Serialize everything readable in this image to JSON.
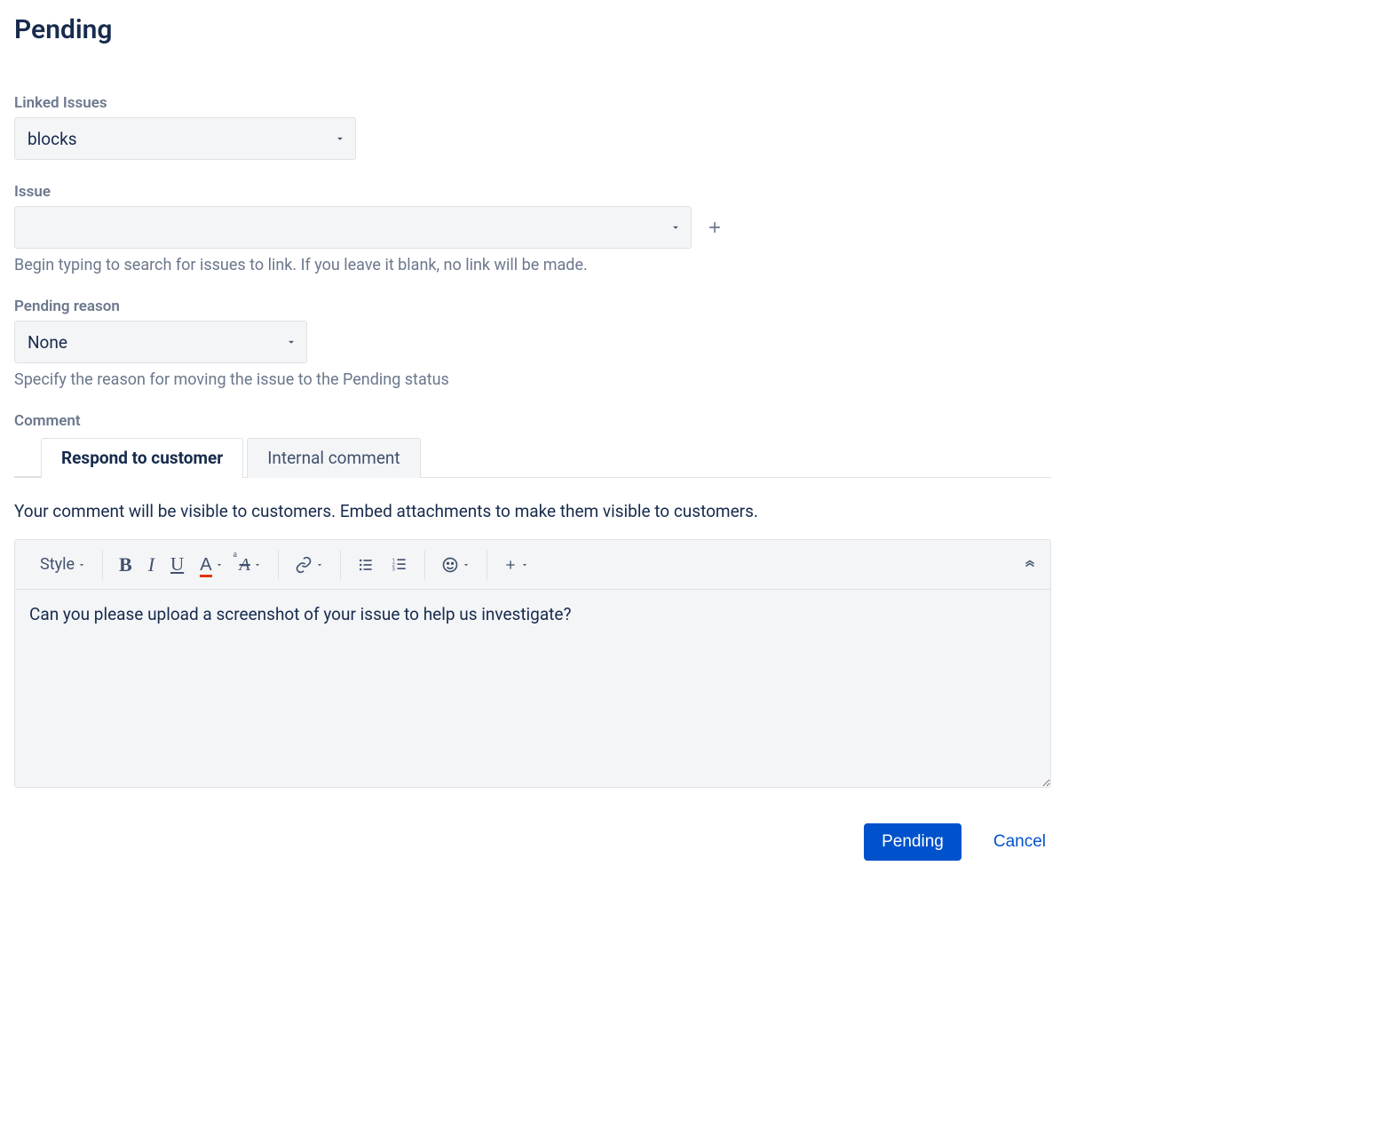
{
  "title": "Pending",
  "linked_issues": {
    "label": "Linked Issues",
    "value": "blocks"
  },
  "issue": {
    "label": "Issue",
    "value": "",
    "helper": "Begin typing to search for issues to link. If you leave it blank, no link will be made."
  },
  "pending_reason": {
    "label": "Pending reason",
    "value": "None",
    "helper": "Specify the reason for moving the issue to the Pending status"
  },
  "comment": {
    "label": "Comment",
    "tabs": {
      "respond": "Respond to customer",
      "internal": "Internal comment"
    },
    "note": "Your comment will be visible to customers. Embed attachments to make them visible to customers.",
    "toolbar": {
      "style": "Style"
    },
    "body": "Can you please upload a screenshot of your issue to help us investigate?"
  },
  "footer": {
    "submit": "Pending",
    "cancel": "Cancel"
  }
}
